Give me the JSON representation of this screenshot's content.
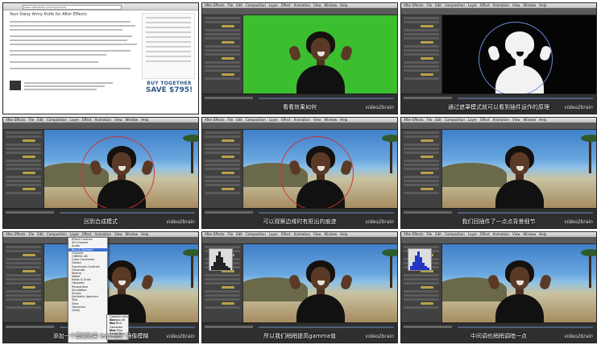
{
  "watermark": "video2brain",
  "menu_bar": [
    "After Effects",
    "File",
    "Edit",
    "Composition",
    "Layer",
    "Effect",
    "Animation",
    "View",
    "Window",
    "Help"
  ],
  "webpage": {
    "address": "www.video2brain.com/de/products",
    "title": "Your Daisy Army Knife for After Effects",
    "buy_line1": "BUY TOGETHER",
    "buy_line2": "SAVE $795!"
  },
  "frames": [
    {
      "id": "f1",
      "scene": "web",
      "subtitle": ""
    },
    {
      "id": "f2",
      "scene": "green",
      "subtitle": "看看效果如何"
    },
    {
      "id": "f3",
      "scene": "matte",
      "subtitle": "通过遮罩模式就可以看到插件运作的原理"
    },
    {
      "id": "f4",
      "scene": "beach",
      "subtitle": "回到合成模式"
    },
    {
      "id": "f5",
      "scene": "beach",
      "subtitle": "可以观察边缘时有抠出的痕迹"
    },
    {
      "id": "f6",
      "scene": "beach",
      "subtitle": "我们回插件了一点点背景细节"
    },
    {
      "id": "f7",
      "scene": "beach",
      "subtitle": "添加一个模糊效果 lens blur 镜像模糊"
    },
    {
      "id": "f8",
      "scene": "beach",
      "subtitle": "所以我们稍稍提高gamma值"
    },
    {
      "id": "f9",
      "scene": "beach",
      "subtitle": "中间调也稍稍调暗一点"
    }
  ],
  "effects_menu": {
    "items": [
      "Effect Controls",
      "3D Channel",
      "Audio",
      "Blur & Sharpen",
      "Channel",
      "CINEMA 4D",
      "Color Correction",
      "Distort",
      "Expression Controls",
      "Generate",
      "Keying",
      "Matte",
      "Noise & Grain",
      "Obsolete",
      "Perspective",
      "Simulation",
      "Stylize",
      "Synthetic Aperture",
      "Text",
      "Time",
      "Transition",
      "Utility"
    ],
    "selected": "Blur & Sharpen",
    "submenu": [
      "Camera Lens Blur",
      "Compound Blur",
      "Fast Blur",
      "Gaussian Blur",
      "Lens Blur",
      "Radial Blur",
      "Sharpen"
    ]
  }
}
